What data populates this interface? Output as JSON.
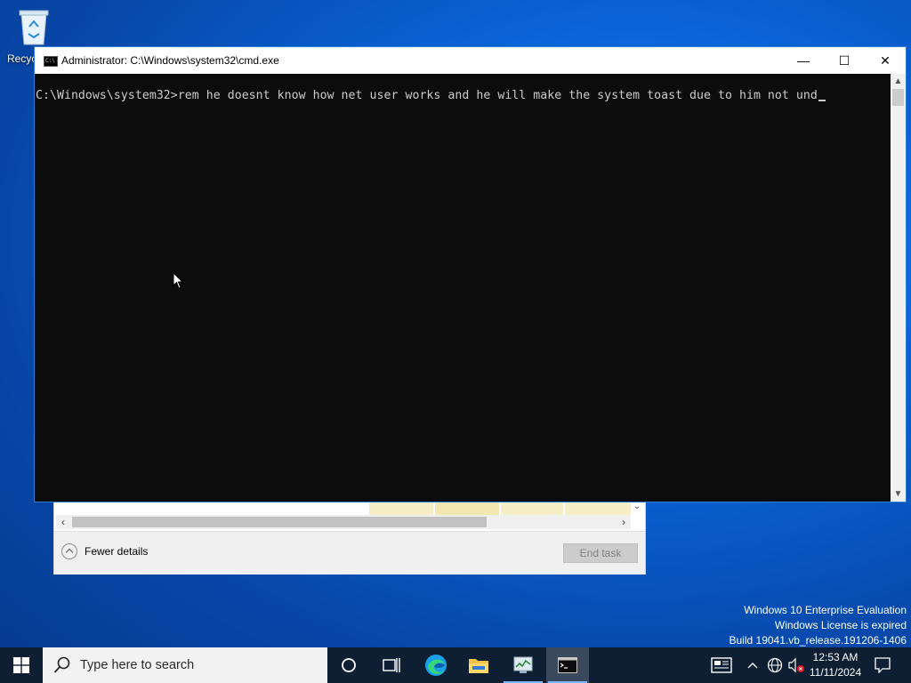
{
  "desktop": {
    "recycle_bin_label": "Recyc"
  },
  "task_manager": {
    "fewer_details_label": "Fewer details",
    "end_task_label": "End task"
  },
  "cmd_window": {
    "title": "Administrator: C:\\Windows\\system32\\cmd.exe",
    "icon_glyph": "C:\\",
    "prompt": "C:\\Windows\\system32>",
    "typed_command": "rem he doesnt know how net user works and he will make the system toast due to him not und",
    "minimize_glyph": "—",
    "maximize_glyph": "☐",
    "close_glyph": "✕"
  },
  "watermark": {
    "line1": "Windows 10 Enterprise Evaluation",
    "line2": "Windows License is expired",
    "line3": "Build 19041.vb_release.191206-1406"
  },
  "taskbar": {
    "search_placeholder": "Type here to search",
    "pinned": [
      {
        "name": "cortana",
        "icon": "circle-icon"
      },
      {
        "name": "task-view",
        "icon": "task-view-icon"
      },
      {
        "name": "edge",
        "icon": "edge-icon"
      },
      {
        "name": "file-explorer",
        "icon": "folder-icon"
      },
      {
        "name": "task-manager",
        "icon": "task-manager-icon"
      },
      {
        "name": "command-prompt",
        "icon": "cmd-icon",
        "active": true
      }
    ],
    "time": "12:53 AM",
    "date": "11/11/2024"
  },
  "colors": {
    "accent": "#0a63d6",
    "taskbar_bg": "#0f1f33",
    "console_bg": "#0c0c0c",
    "console_fg": "#cccccc"
  }
}
